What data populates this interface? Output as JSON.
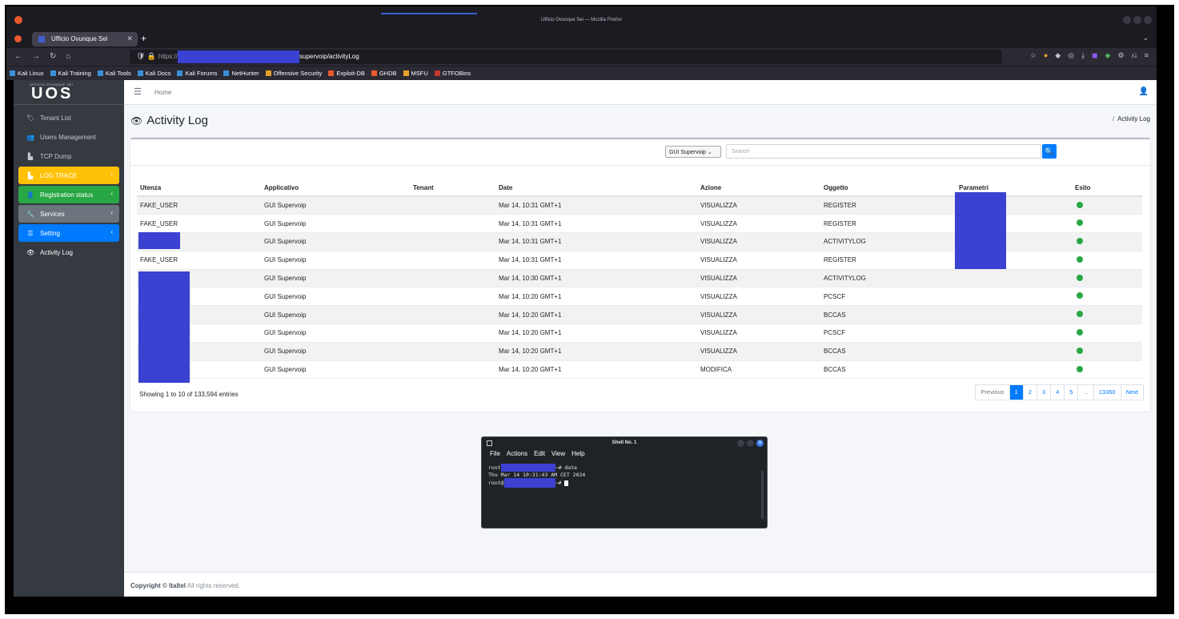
{
  "browser": {
    "window_title": "Ufficio Ovunque Sei — Mozilla Firefox",
    "tab_title": "Ufficio Ovunque Sei",
    "url_prefix": "https://",
    "url_path": "supervoip/activityLog",
    "bookmarks": [
      {
        "label": "Kali Linux",
        "color": "#3b8fd8"
      },
      {
        "label": "Kali Training",
        "color": "#3b8fd8"
      },
      {
        "label": "Kali Tools",
        "color": "#3b8fd8"
      },
      {
        "label": "Kali Docs",
        "color": "#3b8fd8"
      },
      {
        "label": "Kali Forums",
        "color": "#3b8fd8"
      },
      {
        "label": "NetHunter",
        "color": "#3b8fd8"
      },
      {
        "label": "Offensive Security",
        "color": "#e5a028"
      },
      {
        "label": "Exploit-DB",
        "color": "#e8592e"
      },
      {
        "label": "GHDB",
        "color": "#e8592e"
      },
      {
        "label": "MSFU",
        "color": "#e5a028"
      },
      {
        "label": "GTFOBins",
        "color": "#c0392b"
      }
    ]
  },
  "brand": {
    "small_text": "UFFICIO OVUNQUE SEI",
    "logo": "UOS"
  },
  "sidebar": {
    "items": [
      {
        "label": "Tenant List",
        "icon": "tag-icon",
        "glyph": "🏷",
        "style": ""
      },
      {
        "label": "Users Management",
        "icon": "users-icon",
        "glyph": "👥",
        "style": ""
      },
      {
        "label": "TCP Dump",
        "icon": "file-icon",
        "glyph": "▙",
        "style": ""
      },
      {
        "label": "LOG TRACE",
        "icon": "file-icon",
        "glyph": "▙",
        "style": "yellow",
        "chevron": "‹"
      },
      {
        "label": "Registration status",
        "icon": "user-icon",
        "glyph": "👤",
        "style": "green",
        "chevron": "‹"
      },
      {
        "label": "Services",
        "icon": "wrench-icon",
        "glyph": "🔧",
        "style": "grey",
        "chevron": "‹"
      },
      {
        "label": "Setting",
        "icon": "bars-icon",
        "glyph": "☰",
        "style": "blue",
        "chevron": "‹"
      },
      {
        "label": "Activity Log",
        "icon": "eye-icon",
        "glyph": "👁",
        "style": "active-sub"
      }
    ]
  },
  "topnav": {
    "home": "Home"
  },
  "page": {
    "title": "Activity Log",
    "breadcrumb": "Activity Log"
  },
  "filters": {
    "select_value": "GUI Supervoip",
    "search_placeholder": "Search"
  },
  "table": {
    "headers": [
      "Utenza",
      "Applicativo",
      "Tenant",
      "Date",
      "Azione",
      "Oggetto",
      "Parametri",
      "Esito"
    ],
    "rows": [
      {
        "utenza": "FAKE_USER",
        "applicativo": "GUI Supervoip",
        "tenant": "",
        "date": "Mar 14, 10:31 GMT+1",
        "azione": "VISUALIZZA",
        "oggetto": "REGISTER",
        "parametri": "",
        "esito": "success"
      },
      {
        "utenza": "FAKE_USER",
        "applicativo": "GUI Supervoip",
        "tenant": "",
        "date": "Mar 14, 10:31 GMT+1",
        "azione": "VISUALIZZA",
        "oggetto": "REGISTER",
        "parametri": "",
        "esito": "success"
      },
      {
        "utenza": "",
        "applicativo": "GUI Supervoip",
        "tenant": "",
        "date": "Mar 14, 10:31 GMT+1",
        "azione": "VISUALIZZA",
        "oggetto": "ACTIVITYLOG",
        "parametri": "",
        "esito": "success"
      },
      {
        "utenza": "FAKE_USER",
        "applicativo": "GUI Supervoip",
        "tenant": "",
        "date": "Mar 14, 10:31 GMT+1",
        "azione": "VISUALIZZA",
        "oggetto": "REGISTER",
        "parametri": "",
        "esito": "success"
      },
      {
        "utenza": "",
        "applicativo": "GUI Supervoip",
        "tenant": "",
        "date": "Mar 14, 10:30 GMT+1",
        "azione": "VISUALIZZA",
        "oggetto": "ACTIVITYLOG",
        "parametri": "",
        "esito": "success"
      },
      {
        "utenza": "",
        "applicativo": "GUI Supervoip",
        "tenant": "",
        "date": "Mar 14, 10:20 GMT+1",
        "azione": "VISUALIZZA",
        "oggetto": "PCSCF",
        "parametri": "",
        "esito": "success"
      },
      {
        "utenza": "",
        "applicativo": "GUI Supervoip",
        "tenant": "",
        "date": "Mar 14, 10:20 GMT+1",
        "azione": "VISUALIZZA",
        "oggetto": "BCCAS",
        "parametri": "",
        "esito": "success"
      },
      {
        "utenza": "",
        "applicativo": "GUI Supervoip",
        "tenant": "",
        "date": "Mar 14, 10:20 GMT+1",
        "azione": "VISUALIZZA",
        "oggetto": "PCSCF",
        "parametri": "",
        "esito": "success"
      },
      {
        "utenza": "",
        "applicativo": "GUI Supervoip",
        "tenant": "",
        "date": "Mar 14, 10:20 GMT+1",
        "azione": "VISUALIZZA",
        "oggetto": "BCCAS",
        "parametri": "",
        "esito": "success"
      },
      {
        "utenza": "",
        "applicativo": "GUI Supervoip",
        "tenant": "",
        "date": "Mar 14, 10:20 GMT+1",
        "azione": "MODIFICA",
        "oggetto": "BCCAS",
        "parametri": "",
        "esito": "success"
      }
    ],
    "info": "Showing 1 to 10 of 133,594 entries",
    "pagination": [
      "Previous",
      "1",
      "2",
      "3",
      "4",
      "5",
      "...",
      "13360",
      "Next"
    ],
    "current_page": "1",
    "status_color": "#28a745"
  },
  "footer": {
    "bold": "Copyright © Italtel",
    "rest": " All rights reserved."
  },
  "terminal": {
    "title": "Shell No. 1",
    "menu": [
      "File",
      "Actions",
      "Edit",
      "View",
      "Help"
    ],
    "line1_prefix": "root",
    "line1_suffix": "~# date",
    "line2": "Thu Mar 14 10:31:43 AM CET 2024",
    "line3_prefix": "root@",
    "line3_suffix": "~#"
  }
}
